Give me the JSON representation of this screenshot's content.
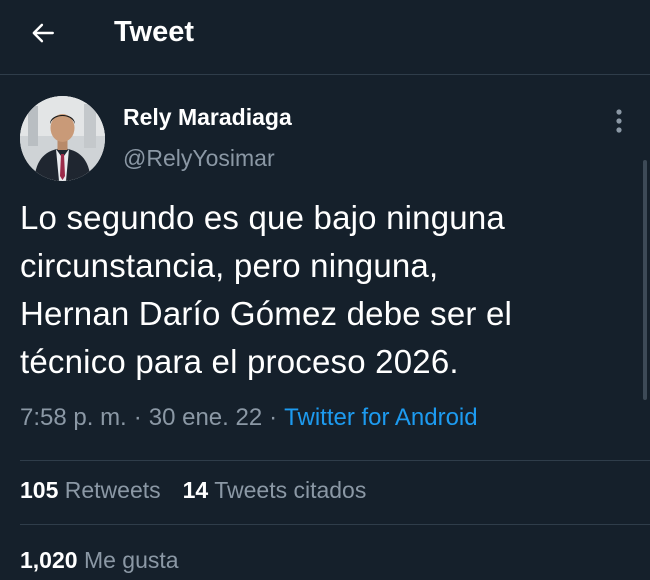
{
  "header": {
    "title": "Tweet"
  },
  "author": {
    "name": "Rely Maradiaga",
    "handle": "@RelyYosimar"
  },
  "tweet": {
    "lines": [
      "Lo segundo es que bajo ninguna",
      "circunstancia, pero ninguna,",
      "Hernan Darío Gómez debe ser el",
      "técnico para el proceso 2026."
    ]
  },
  "meta": {
    "time": "7:58 p. m.",
    "separator": "·",
    "date": "30 ene. 22",
    "source": "Twitter for Android"
  },
  "stats": {
    "retweets_count": "105",
    "retweets_label": "Retweets",
    "quotes_count": "14",
    "quotes_label": "Tweets citados",
    "likes_count": "1,020",
    "likes_label": "Me gusta"
  },
  "colors": {
    "background": "#15202b",
    "text_primary": "#ffffff",
    "text_secondary": "#8b98a5",
    "link": "#1d9bf0",
    "divider": "#2f3d4a"
  },
  "icons": {
    "back": "arrow-left-icon",
    "more": "more-vertical-icon"
  }
}
